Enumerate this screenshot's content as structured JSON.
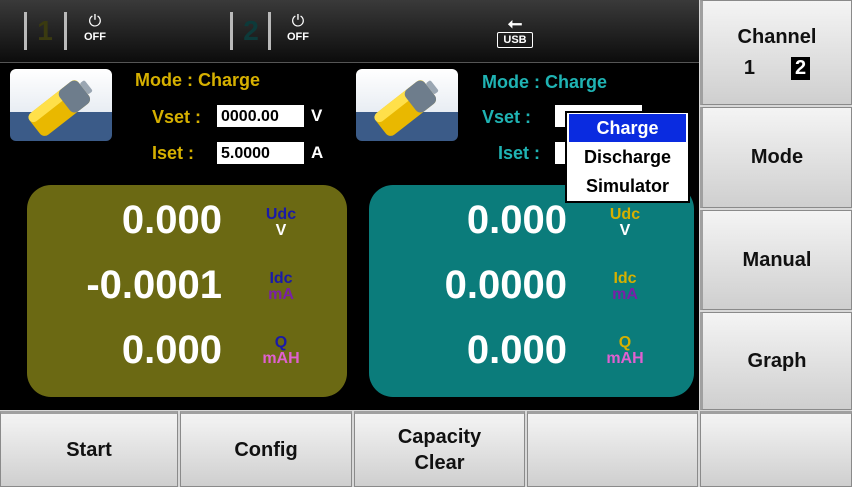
{
  "statusbar": {
    "ch1_number": "1",
    "ch2_number": "2",
    "power_label": "OFF",
    "usb_label": "USB",
    "ch1_number_color": "#3a3a10",
    "ch2_number_color": "#0d3a3a"
  },
  "ch1": {
    "mode_label": "Mode :",
    "mode_value": "Charge",
    "vset_label": "Vset :",
    "vset_value": "0000.00",
    "vset_unit": "V",
    "iset_label": "Iset :",
    "iset_value": "5.0000",
    "iset_unit": "A",
    "panel_color": "#6b6913",
    "voltage": "0.000",
    "current": "-0.0001",
    "capacity": "0.000",
    "v_name": "Udc",
    "v_unit": "V",
    "i_name": "Idc",
    "i_unit": "mA",
    "q_name": "Q",
    "q_unit": "mAH"
  },
  "ch2": {
    "mode_label": "Mode :",
    "mode_value": "Charge",
    "vset_label": "Vset :",
    "iset_label": "Iset :",
    "panel_color": "#0b7c7b",
    "voltage": "0.000",
    "current": "0.0000",
    "capacity": "0.000",
    "v_name": "Udc",
    "v_unit": "V",
    "i_name": "Idc",
    "i_unit": "mA",
    "q_name": "Q",
    "q_unit": "mAH"
  },
  "mode_dropdown": {
    "options": [
      "Charge",
      "Discharge",
      "Simulator"
    ],
    "selected": "Charge"
  },
  "right_menu": {
    "channel_label": "Channel",
    "channel_opt1": "1",
    "channel_opt2": "2",
    "mode_label": "Mode",
    "manual_label": "Manual",
    "graph_label": "Graph"
  },
  "bottom_menu": {
    "start_label": "Start",
    "config_label": "Config",
    "capacity_line1": "Capacity",
    "capacity_line2": "Clear",
    "empty4": "",
    "empty5": ""
  },
  "colors": {
    "label_yellow": "#d6b000",
    "label_teal": "#1fb3b3",
    "udc_blue": "#1a1aa8",
    "idc_purple": "#7a1fa8",
    "q_pink": "#e060d0"
  }
}
